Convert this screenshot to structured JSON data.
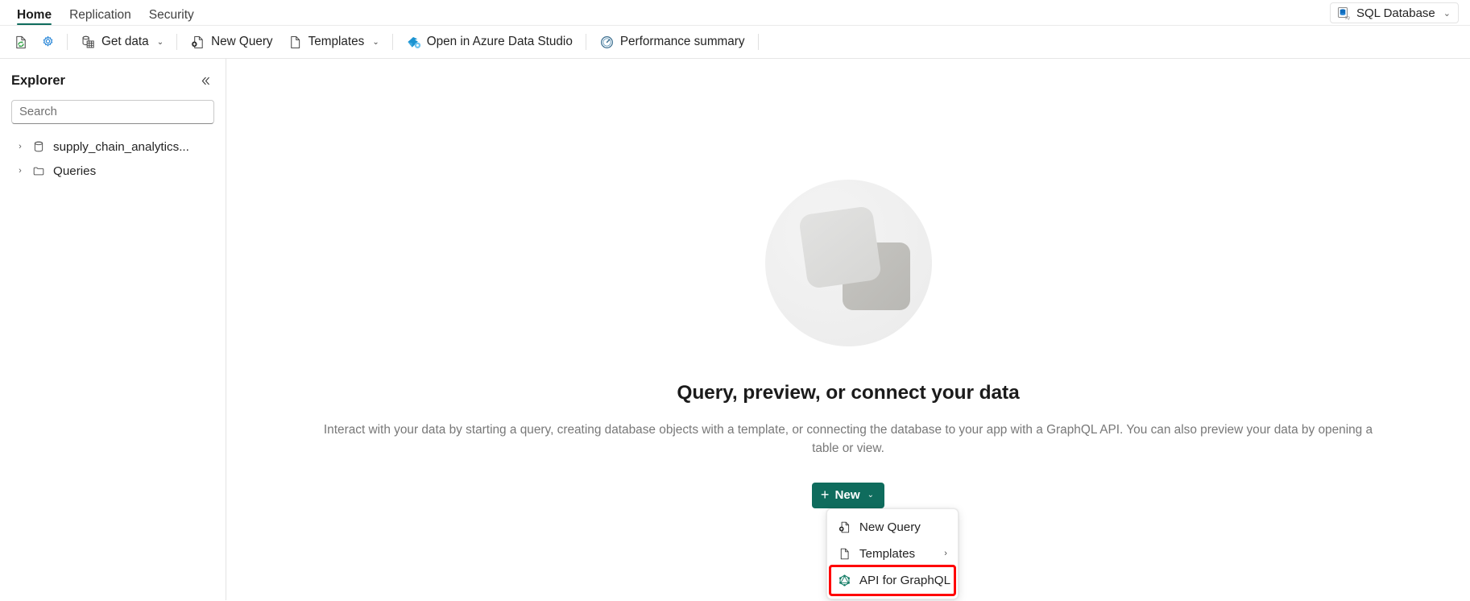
{
  "ribbon": {
    "tabs": [
      {
        "label": "Home",
        "active": true
      },
      {
        "label": "Replication",
        "active": false
      },
      {
        "label": "Security",
        "active": false
      }
    ],
    "context_pill": {
      "label": "SQL Database",
      "icon": "sql-database-icon",
      "chevron": "⌄"
    }
  },
  "toolbar": {
    "refresh_icon": "refresh-page-icon",
    "settings_icon": "gear-icon",
    "get_data": {
      "label": "Get data",
      "icon": "database-table-icon",
      "chevron": "⌄"
    },
    "new_query": {
      "label": "New Query",
      "icon": "new-query-icon"
    },
    "templates": {
      "label": "Templates",
      "icon": "document-icon",
      "chevron": "⌄"
    },
    "open_ads": {
      "label": "Open in Azure Data Studio",
      "icon": "azure-data-studio-icon"
    },
    "performance": {
      "label": "Performance summary",
      "icon": "gauge-icon"
    }
  },
  "sidebar": {
    "title": "Explorer",
    "collapse_icon": "collapse-chevrons-icon",
    "search": {
      "placeholder": "Search",
      "value": ""
    },
    "tree": [
      {
        "label": "supply_chain_analytics...",
        "icon": "database-icon",
        "chevron": "›",
        "expanded": false
      },
      {
        "label": "Queries",
        "icon": "folder-icon",
        "chevron": "›",
        "expanded": false
      }
    ]
  },
  "main": {
    "illustration": "two-cards-illustration",
    "title": "Query, preview, or connect your data",
    "body": "Interact with your data by starting a query, creating database objects with a template, or connecting the database to your app with a GraphQL API. You can also preview your data by opening a table or view.",
    "new_button": {
      "label": "New",
      "plus": "+",
      "chevron": "⌄"
    },
    "menu": [
      {
        "label": "New Query",
        "icon": "new-query-icon",
        "submenu": false,
        "highlighted": false
      },
      {
        "label": "Templates",
        "icon": "document-icon",
        "submenu": true,
        "submenu_chevron": "›",
        "highlighted": false
      },
      {
        "label": "API for GraphQL",
        "icon": "graphql-icon",
        "submenu": false,
        "highlighted": true
      }
    ]
  },
  "colors": {
    "accent_green": "#0f6c5d",
    "highlight_red": "#ff0000",
    "text_primary": "#242424",
    "text_secondary": "#787878",
    "icon_blue": "#0078d4",
    "icon_green": "#3aa44c"
  }
}
